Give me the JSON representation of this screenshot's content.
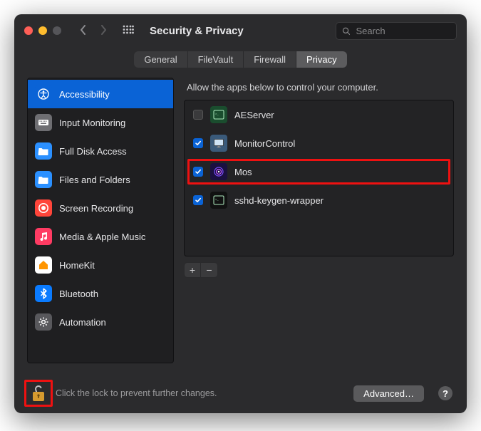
{
  "window": {
    "title": "Security & Privacy"
  },
  "search": {
    "placeholder": "Search"
  },
  "tabs": [
    {
      "label": "General",
      "active": false
    },
    {
      "label": "FileVault",
      "active": false
    },
    {
      "label": "Firewall",
      "active": false
    },
    {
      "label": "Privacy",
      "active": true
    }
  ],
  "sidebar": {
    "items": [
      {
        "label": "Accessibility",
        "icon": "accessibility-icon",
        "bg": "#0a63d6",
        "selected": true
      },
      {
        "label": "Input Monitoring",
        "icon": "keyboard-icon",
        "bg": "#6e6e72",
        "selected": false
      },
      {
        "label": "Full Disk Access",
        "icon": "folder-icon",
        "bg": "#2b90ff",
        "selected": false
      },
      {
        "label": "Files and Folders",
        "icon": "folder-icon",
        "bg": "#2b90ff",
        "selected": false
      },
      {
        "label": "Screen Recording",
        "icon": "record-icon",
        "bg": "#ff453a",
        "selected": false
      },
      {
        "label": "Media & Apple Music",
        "icon": "music-icon",
        "bg": "#ff3b63",
        "selected": false
      },
      {
        "label": "HomeKit",
        "icon": "home-icon",
        "bg": "#ffffff",
        "fg": "#ff9500",
        "selected": false
      },
      {
        "label": "Bluetooth",
        "icon": "bluetooth-icon",
        "bg": "#0a7bff",
        "selected": false
      },
      {
        "label": "Automation",
        "icon": "gear-icon",
        "bg": "#58585c",
        "selected": false
      }
    ]
  },
  "main": {
    "instruction": "Allow the apps below to control your computer.",
    "apps": [
      {
        "label": "AEServer",
        "checked": false,
        "icon": "terminal-icon",
        "icon_bg": "#1a4d2e",
        "highlighted": false
      },
      {
        "label": "MonitorControl",
        "checked": true,
        "icon": "monitor-icon",
        "icon_bg": "#3a5a7a",
        "highlighted": false
      },
      {
        "label": "Mos",
        "checked": true,
        "icon": "mos-icon",
        "icon_bg": "#1a1040",
        "highlighted": true
      },
      {
        "label": "sshd-keygen-wrapper",
        "checked": true,
        "icon": "terminal-icon",
        "icon_bg": "#111111",
        "highlighted": false
      }
    ],
    "add_label": "+",
    "remove_label": "−"
  },
  "footer": {
    "lock_text": "Click the lock to prevent further changes.",
    "advanced_label": "Advanced…",
    "help_label": "?"
  }
}
